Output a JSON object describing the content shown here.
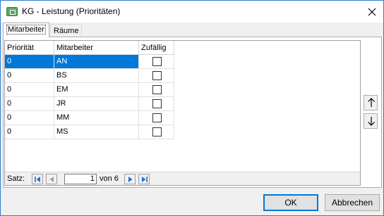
{
  "window": {
    "title": "KG - Leistung (Prioritäten)"
  },
  "tabs": [
    {
      "label": "Mitarbeiter",
      "active": true
    },
    {
      "label": "Räume",
      "active": false
    }
  ],
  "grid": {
    "columns": [
      "Priorität",
      "Mitarbeiter",
      "Zufällig"
    ],
    "rows": [
      {
        "priority": "0",
        "employee": "AN",
        "random": false,
        "selected": true
      },
      {
        "priority": "0",
        "employee": "BS",
        "random": false,
        "selected": false
      },
      {
        "priority": "0",
        "employee": "EM",
        "random": false,
        "selected": false
      },
      {
        "priority": "0",
        "employee": "JR",
        "random": false,
        "selected": false
      },
      {
        "priority": "0",
        "employee": "MM",
        "random": false,
        "selected": false
      },
      {
        "priority": "0",
        "employee": "MS",
        "random": false,
        "selected": false
      }
    ]
  },
  "navigator": {
    "label": "Satz:",
    "current": "1",
    "of_text": "von  6"
  },
  "buttons": {
    "ok": "OK",
    "cancel": "Abbrechen"
  },
  "icons": {
    "title": "app-window-icon",
    "close": "close-icon",
    "first": "first-record-icon",
    "prev": "prev-record-icon",
    "next": "next-record-icon",
    "last": "last-record-icon",
    "up": "arrow-up-icon",
    "down": "arrow-down-icon"
  },
  "colors": {
    "selection": "#0078d7",
    "nav_enabled": "#1e6fd9",
    "nav_disabled": "#a0a0a0"
  }
}
